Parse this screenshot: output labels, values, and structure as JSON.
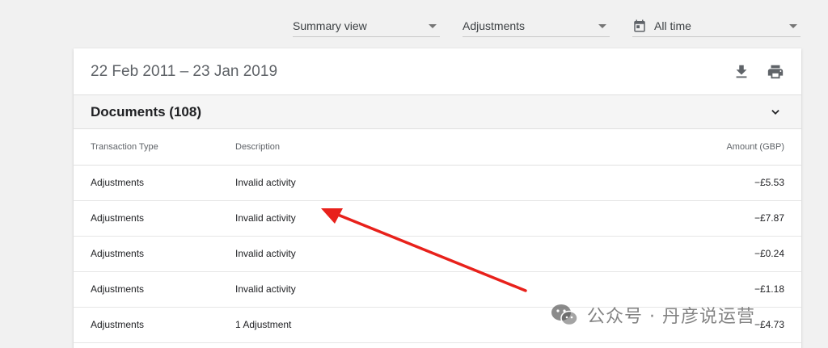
{
  "filters": {
    "view": "Summary view",
    "type": "Adjustments",
    "date": "All time"
  },
  "card": {
    "date_range": "22 Feb 2011 – 23 Jan 2019",
    "section_title": "Documents (108)"
  },
  "table": {
    "headers": {
      "type": "Transaction Type",
      "description": "Description",
      "amount": "Amount (GBP)"
    },
    "rows": [
      {
        "type": "Adjustments",
        "description": "Invalid activity",
        "amount": "−£5.53"
      },
      {
        "type": "Adjustments",
        "description": "Invalid activity",
        "amount": "−£7.87"
      },
      {
        "type": "Adjustments",
        "description": "Invalid activity",
        "amount": "−£0.24"
      },
      {
        "type": "Adjustments",
        "description": "Invalid activity",
        "amount": "−£1.18"
      },
      {
        "type": "Adjustments",
        "description": "1 Adjustment",
        "amount": "−£4.73"
      }
    ]
  },
  "annotation": {
    "arrow_color": "#e8211b"
  },
  "watermark": {
    "text": "公众号 · 丹彦说运营"
  },
  "icons": {
    "date": "calendar-icon",
    "download": "download-icon",
    "print": "print-icon",
    "expand": "chevron-down-icon"
  }
}
